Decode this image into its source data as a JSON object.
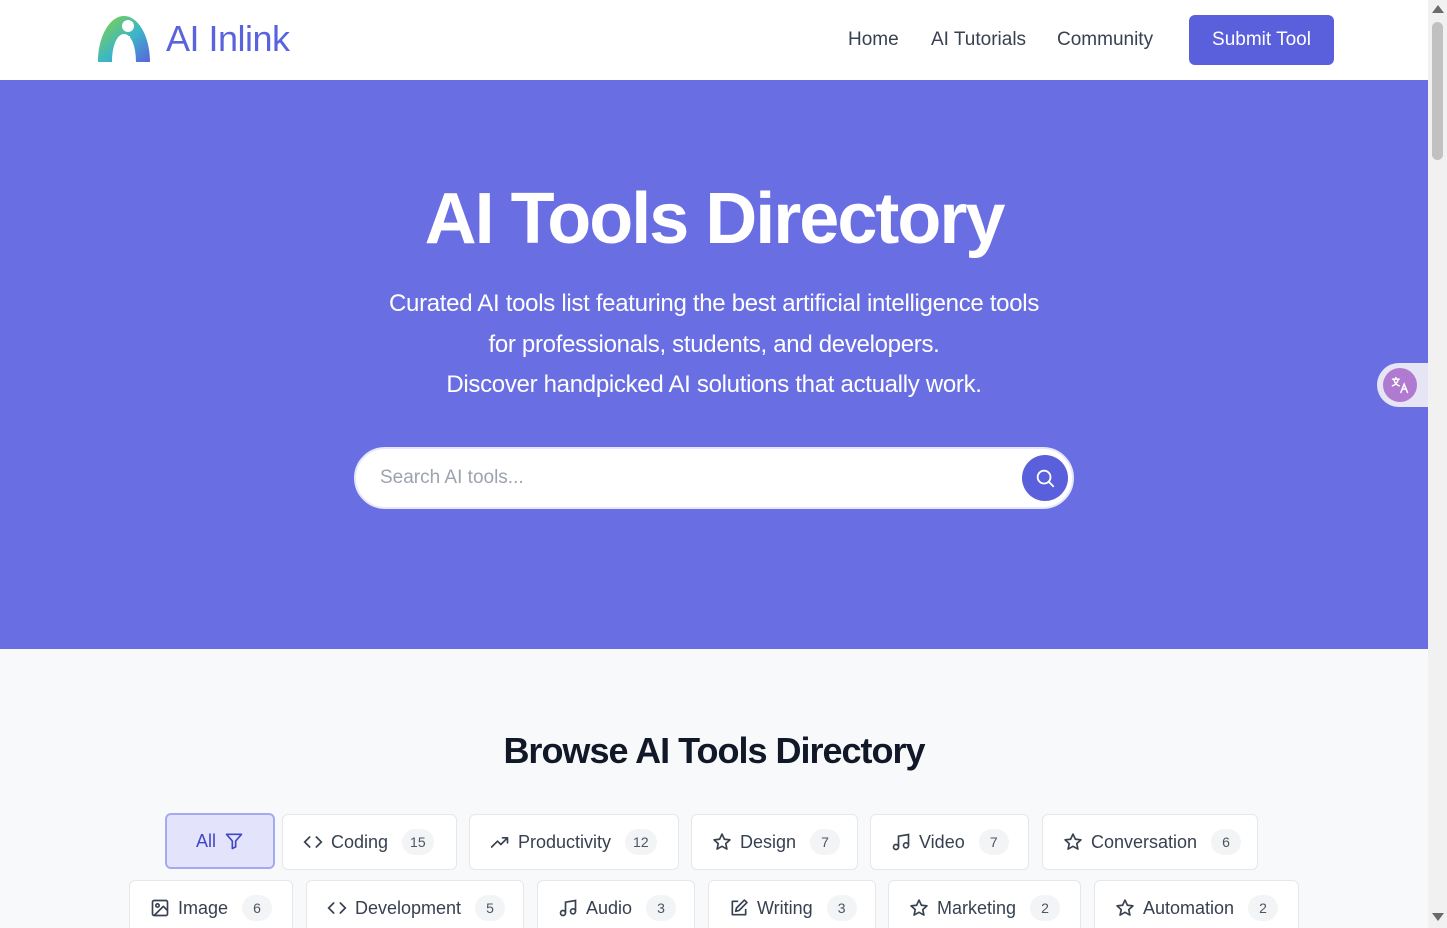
{
  "header": {
    "brand": "AI Inlink",
    "nav": [
      {
        "label": "Home"
      },
      {
        "label": "AI Tutorials"
      },
      {
        "label": "Community"
      }
    ],
    "submit_label": "Submit Tool",
    "colors": {
      "brand": "#5a63de",
      "button": "#5a5fdc"
    }
  },
  "hero": {
    "title": "AI Tools Directory",
    "subtitle_lines": [
      "Curated AI tools list featuring the best artificial intelligence tools",
      "for professionals, students, and developers.",
      "Discover handpicked AI solutions that actually work."
    ],
    "search_placeholder": "Search AI tools...",
    "background": "#6a6ee3"
  },
  "section": {
    "title": "Browse AI Tools Directory"
  },
  "categories": [
    {
      "label": "All",
      "icon": "filter-icon",
      "active": true
    },
    {
      "label": "Coding",
      "icon": "code-icon",
      "count": "15"
    },
    {
      "label": "Productivity",
      "icon": "trending-up-icon",
      "count": "12"
    },
    {
      "label": "Design",
      "icon": "star-icon",
      "count": "7"
    },
    {
      "label": "Video",
      "icon": "music-icon",
      "count": "7"
    },
    {
      "label": "Conversation",
      "icon": "star-icon",
      "count": "6"
    },
    {
      "label": "Image",
      "icon": "image-icon",
      "count": "6"
    },
    {
      "label": "Development",
      "icon": "code-icon",
      "count": "5"
    },
    {
      "label": "Audio",
      "icon": "music-icon",
      "count": "3"
    },
    {
      "label": "Writing",
      "icon": "edit-icon",
      "count": "3"
    },
    {
      "label": "Marketing",
      "icon": "star-icon",
      "count": "2"
    },
    {
      "label": "Automation",
      "icon": "star-icon",
      "count": "2"
    }
  ],
  "translate_widget": {
    "icon": "translate-icon"
  }
}
